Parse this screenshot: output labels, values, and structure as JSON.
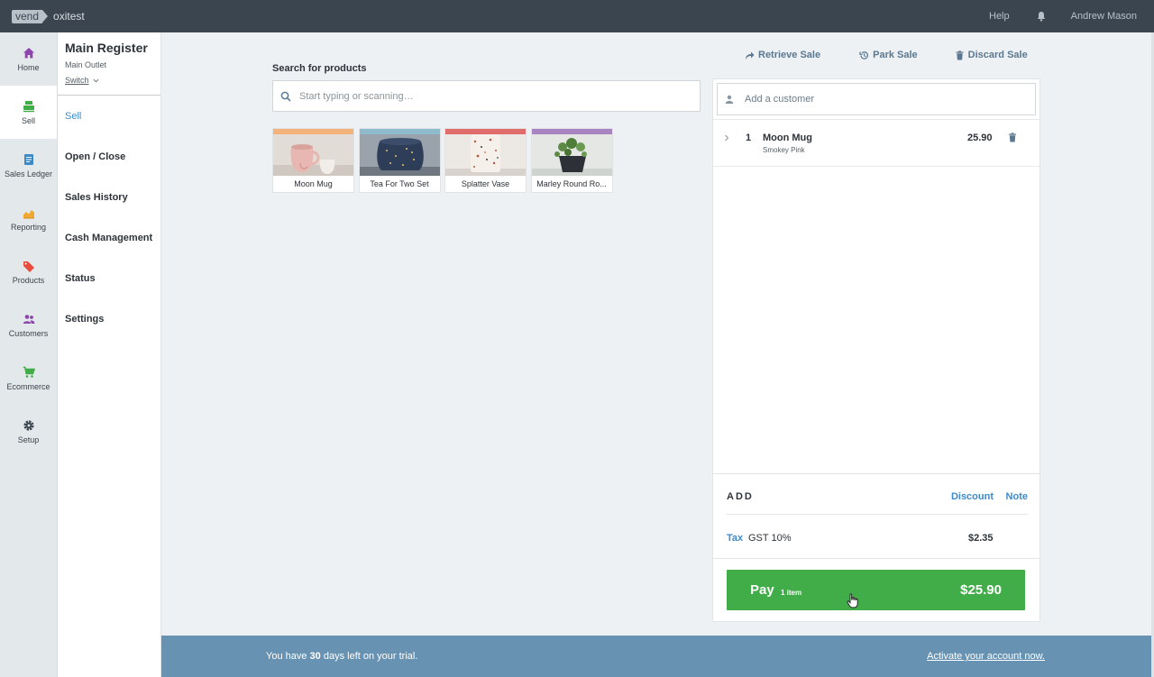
{
  "topbar": {
    "logo_text": "vend",
    "store_name": "oxitest",
    "help": "Help",
    "user": "Andrew Mason"
  },
  "leftnav": [
    {
      "label": "Home",
      "icon": "home-icon",
      "color": "#8e44ad"
    },
    {
      "label": "Sell",
      "icon": "register-icon",
      "color": "#41ad49",
      "active": true
    },
    {
      "label": "Sales Ledger",
      "icon": "ledger-icon",
      "color": "#3d8ac9"
    },
    {
      "label": "Reporting",
      "icon": "chart-icon",
      "color": "#f0a830"
    },
    {
      "label": "Products",
      "icon": "tag-icon",
      "color": "#e74c3c"
    },
    {
      "label": "Customers",
      "icon": "users-icon",
      "color": "#8e44ad"
    },
    {
      "label": "Ecommerce",
      "icon": "cart-icon",
      "color": "#41ad49"
    },
    {
      "label": "Setup",
      "icon": "gear-icon",
      "color": "#3a4550"
    }
  ],
  "register": {
    "title": "Main Register",
    "outlet": "Main Outlet",
    "switch": "Switch"
  },
  "subnav": [
    "Sell",
    "Open / Close",
    "Sales History",
    "Cash Management",
    "Status",
    "Settings"
  ],
  "search": {
    "label": "Search for products",
    "placeholder": "Start typing or scanning…"
  },
  "products": [
    {
      "name": "Moon Mug",
      "color": "#f2b27a"
    },
    {
      "name": "Tea For Two Set",
      "color": "#8fbccc"
    },
    {
      "name": "Splatter Vase",
      "color": "#e06c6c"
    },
    {
      "name": "Marley Round Ro...",
      "color": "#a884c1"
    }
  ],
  "actions": {
    "retrieve": "Retrieve Sale",
    "park": "Park Sale",
    "discard": "Discard Sale"
  },
  "sale": {
    "customer_placeholder": "Add a customer",
    "line_items": [
      {
        "qty": "1",
        "name": "Moon Mug",
        "variant": "Smokey Pink",
        "price": "25.90"
      }
    ],
    "add_label": "ADD",
    "discount": "Discount",
    "note": "Note",
    "tax_link": "Tax",
    "tax_name": "GST 10%",
    "tax_value": "$2.35",
    "pay_label": "Pay",
    "pay_count": "1 item",
    "pay_amount": "$25.90"
  },
  "trial": {
    "prefix": "You have ",
    "days": "30",
    "suffix": " days left on your trial.",
    "link": "Activate your account now."
  }
}
